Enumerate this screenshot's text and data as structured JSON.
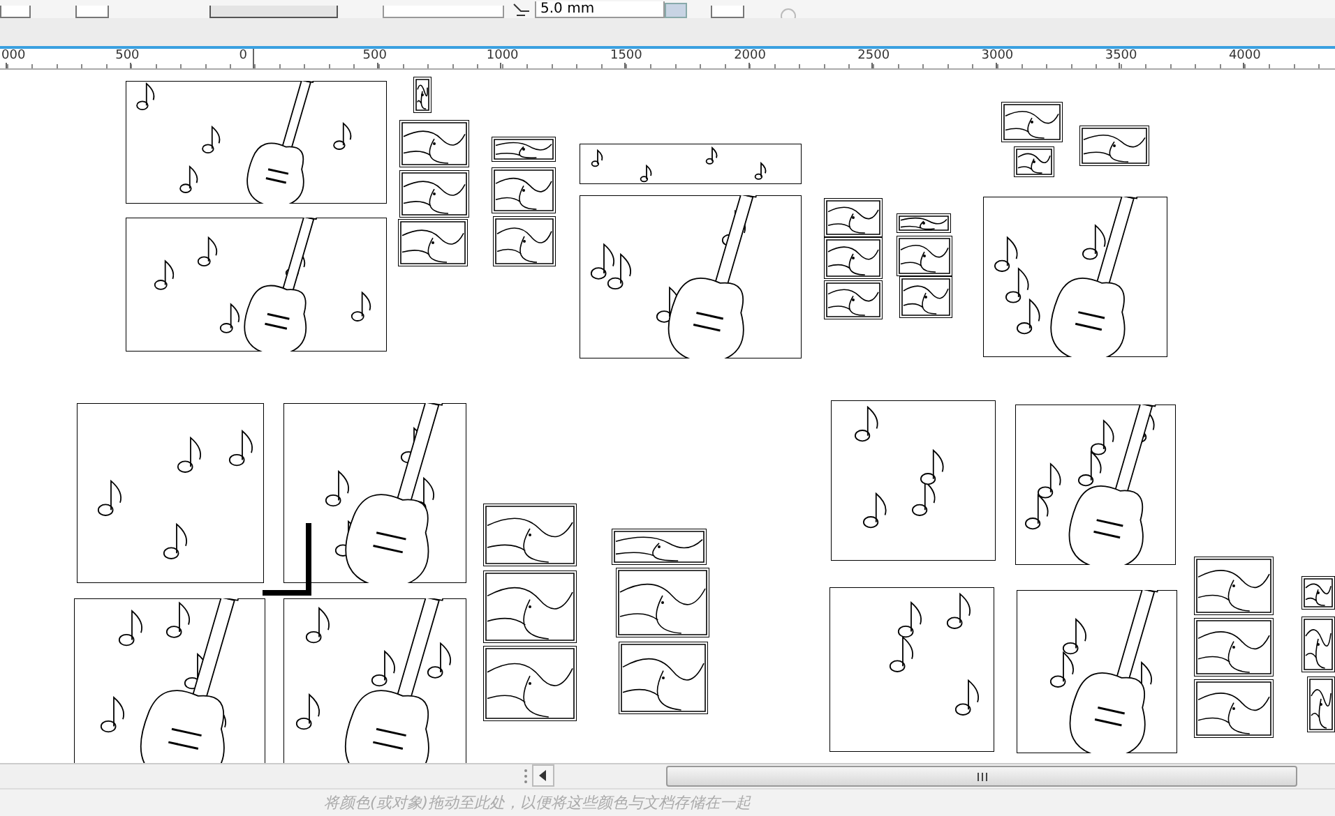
{
  "toolbar": {
    "offset_field": {
      "value": "5.0 mm"
    }
  },
  "ruler": {
    "labels": [
      "000",
      "500",
      "0",
      "500",
      "1000",
      "1500",
      "2000",
      "2500",
      "3000",
      "3500",
      "4000"
    ]
  },
  "status_bar": {
    "hint": "将颜色(或对象)拖动至此处，以便将这些颜色与文档存储在一起"
  }
}
